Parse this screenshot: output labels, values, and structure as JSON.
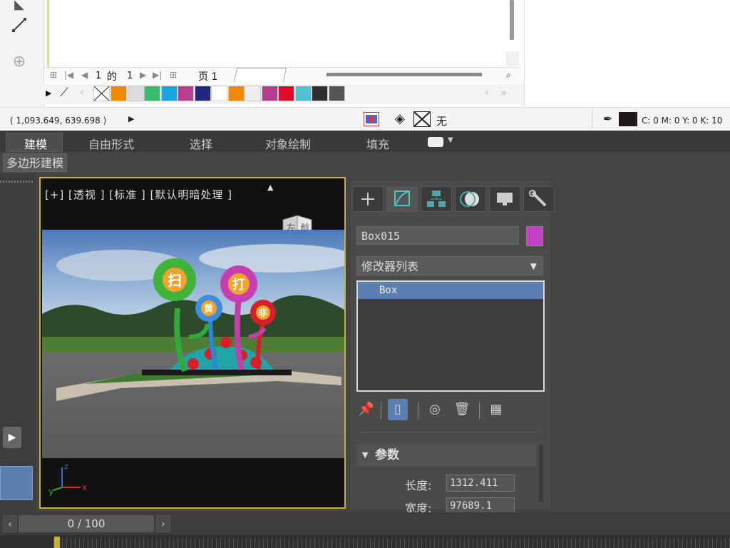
{
  "corel": {
    "page_nav": {
      "current": "1",
      "of_label": "的",
      "total": "1",
      "page_tab": "页 1"
    },
    "status": {
      "coords": "( 1,093.649, 639.698 )",
      "fill_none": "无",
      "cmyk": "C: 0 M: 0 Y: 0 K: 10"
    },
    "palette": [
      "#f08a00",
      "#dcdcdc",
      "#3bba6e",
      "#1aa6e0",
      "#b53f90",
      "#1f2a7e",
      "#ffffff",
      "#f08a00",
      "#eeeeee",
      "#b23f8e",
      "#e00a2a",
      "#53c0d3",
      "#2e2e2e",
      "#555555"
    ]
  },
  "ribbon": {
    "tabs": [
      "建模",
      "自由形式",
      "选择",
      "对象绘制",
      "填充"
    ],
    "active_tab": "建模",
    "sub_button": "多边形建模"
  },
  "viewport": {
    "label": "[+] [透视 ] [标准 ] [默认明暗处理 ]",
    "viewcube_labels": [
      "左",
      "前"
    ],
    "flowers": [
      "扫",
      "黄",
      "打",
      "非"
    ]
  },
  "command_panel": {
    "object_name": "Box015",
    "object_color": "#c33fc3",
    "modifier_list": "修改器列表",
    "stack_items": [
      "Box"
    ],
    "rollout": "参数",
    "params": [
      {
        "label": "长度:",
        "value": "1312.411"
      },
      {
        "label": "宽度:",
        "value": "97689.1"
      }
    ]
  },
  "timeline": {
    "frame_display": "0 / 100"
  }
}
